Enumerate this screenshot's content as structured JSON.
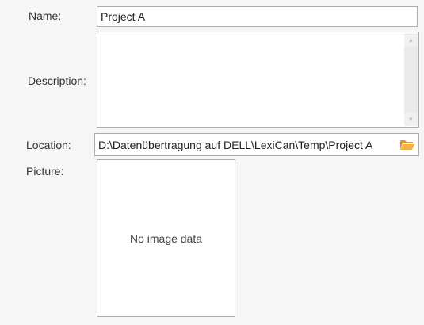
{
  "labels": {
    "name": "Name:",
    "description": "Description:",
    "location": "Location:",
    "picture": "Picture:"
  },
  "fields": {
    "name_value": "Project A",
    "description_value": "",
    "location_value": "D:\\Datenübertragung auf DELL\\LexiCan\\Temp\\Project A"
  },
  "picture": {
    "placeholder_text": "No image data"
  },
  "icons": {
    "browse": "folder-open-icon",
    "scroll_up": "scroll-up-arrow-icon",
    "scroll_down": "scroll-down-arrow-icon"
  },
  "colors": {
    "folder_icon": "#f0a030",
    "border": "#acacac",
    "background": "#f6f6f6"
  }
}
